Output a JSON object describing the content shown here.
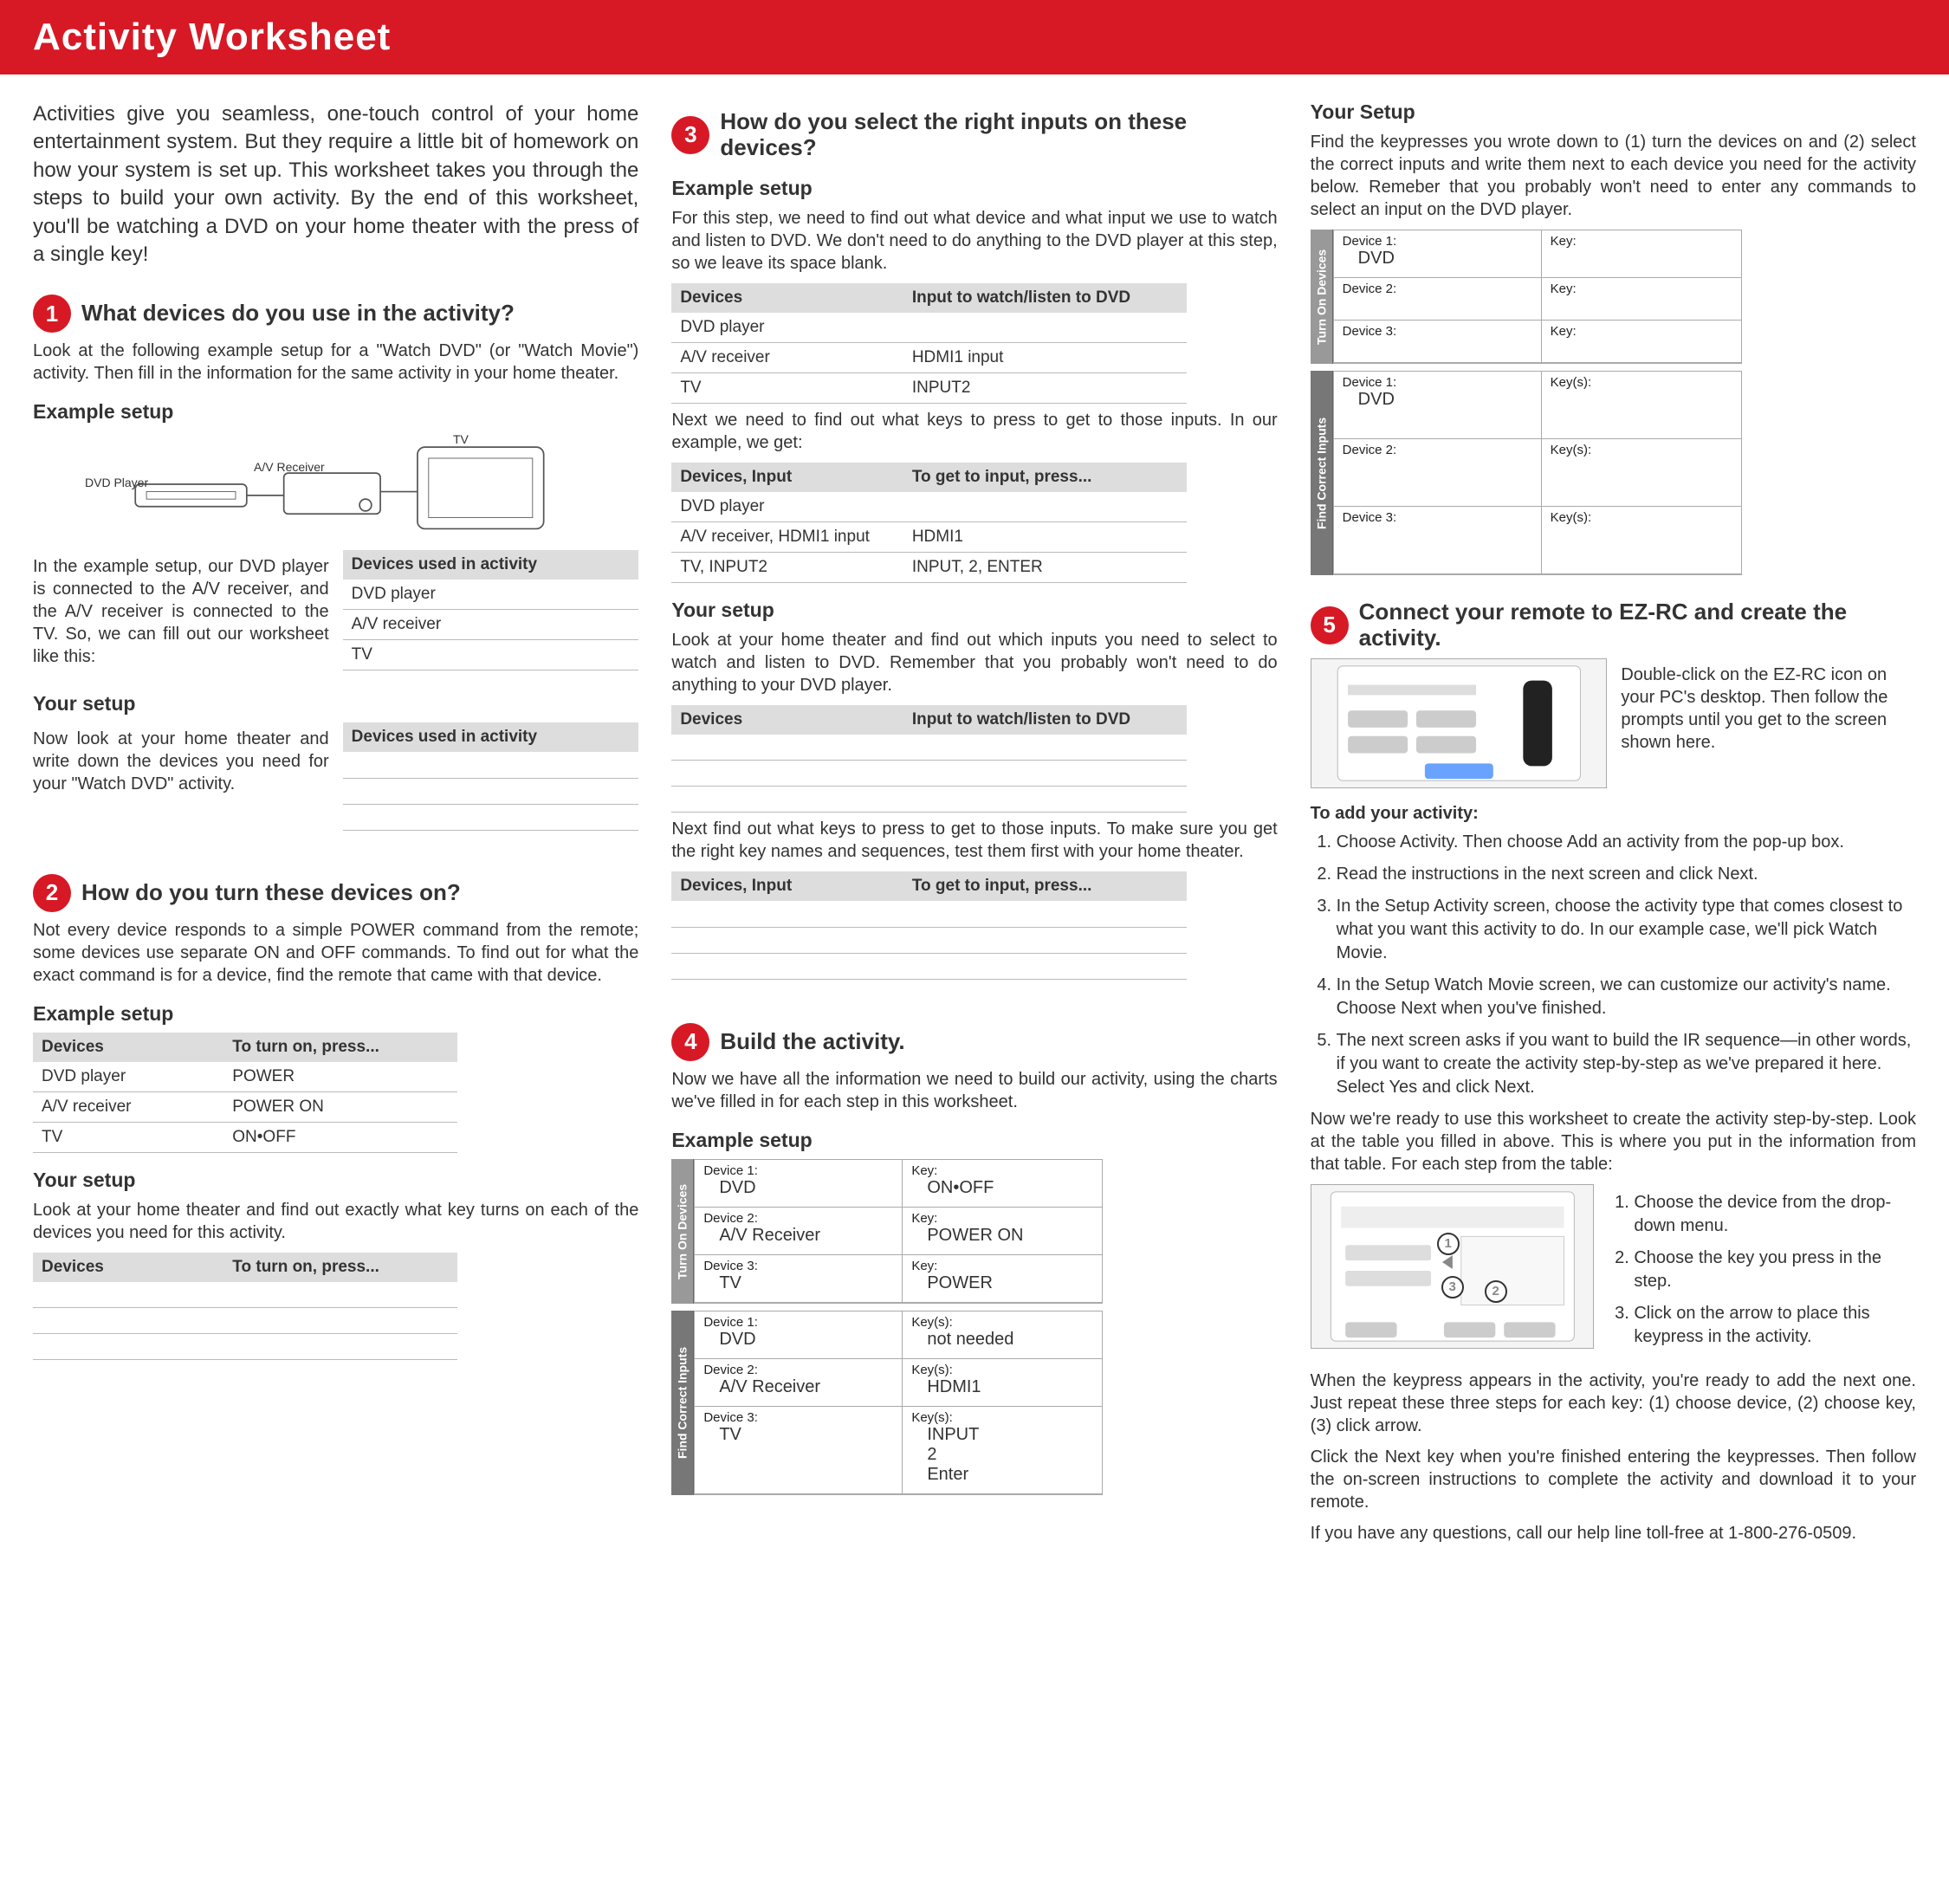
{
  "header": "Activity Worksheet",
  "intro": "Activities give you seamless, one-touch control of your home entertainment system. But they require a little bit of homework on how your system is set up. This worksheet takes you through the steps to build your own activity. By the end of this worksheet, you'll be watching a DVD on your home theater with the press of a single key!",
  "s1": {
    "num": "1",
    "title": "What devices do you use in the activity?",
    "p1": "Look at the following example setup for a \"Watch DVD\" (or \"Watch Movie\") activity. Then fill in the information for the same activity in your home theater.",
    "ex_h": "Example setup",
    "diag": {
      "dvd": "DVD Player",
      "rec": "A/V Receiver",
      "tv": "TV"
    },
    "ex_p": "In the example setup, our DVD player is connected to the A/V receiver, and the A/V receiver is connected to the TV. So, we can fill out our worksheet like this:",
    "ex_tbl_h": "Devices used in activity",
    "ex_tbl": [
      "DVD player",
      "A/V receiver",
      "TV"
    ],
    "ys_h": "Your setup",
    "ys_p": "Now look at your home theater and write down the devices you need for your \"Watch DVD\" activity.",
    "ys_tbl_h": "Devices used in activity"
  },
  "s2": {
    "num": "2",
    "title": "How do you turn these devices on?",
    "p1": "Not every device responds to a simple POWER command from the remote; some devices use separate ON and OFF commands. To find out for what the exact command is for a device, find the remote that came with that device.",
    "ex_h": "Example setup",
    "tbl_h1": "Devices",
    "tbl_h2": "To turn on, press...",
    "rows": [
      {
        "d": "DVD player",
        "k": "POWER"
      },
      {
        "d": "A/V receiver",
        "k": "POWER ON"
      },
      {
        "d": "TV",
        "k": "ON•OFF"
      }
    ],
    "ys_h": "Your setup",
    "ys_p": "Look at your home theater and find out exactly what key turns on each of the devices you need for this activity."
  },
  "s3": {
    "num": "3",
    "title": "How do you select the right inputs on these devices?",
    "ex_h": "Example setup",
    "p1": "For this step, we need to find out what device and what input we use to watch and listen to DVD. We don't need to do anything to the DVD player at this step, so we leave its space blank.",
    "t1h1": "Devices",
    "t1h2": "Input to watch/listen to DVD",
    "t1": [
      {
        "d": "DVD player",
        "i": ""
      },
      {
        "d": "A/V receiver",
        "i": "HDMI1 input"
      },
      {
        "d": "TV",
        "i": "INPUT2"
      }
    ],
    "p2": "Next we need to find out what keys to press to get to those inputs. In our example, we get:",
    "t2h1": "Devices, Input",
    "t2h2": "To get to input, press...",
    "t2": [
      {
        "d": "DVD player",
        "k": ""
      },
      {
        "d": "A/V receiver, HDMI1 input",
        "k": "HDMI1"
      },
      {
        "d": "TV, INPUT2",
        "k": "INPUT, 2, ENTER"
      }
    ],
    "ys_h": "Your setup",
    "ys_p1": "Look at your home theater and find out which inputs you need to select to watch and listen to DVD. Remember that you probably won't need to do anything to your DVD player.",
    "ys_p2": "Next find out what keys to press to get to those inputs. To make sure you get the right key names and sequences, test them first with your home theater."
  },
  "s4": {
    "num": "4",
    "title": "Build the activity.",
    "p1": "Now we have all the information we need to build our activity, using the charts we've filled in for each step in this worksheet.",
    "ex_h": "Example setup",
    "vtab1": "Turn On Devices",
    "vtab2": "Find Correct Inputs",
    "rows_on": [
      {
        "l1": "Device 1:",
        "v1": "DVD",
        "l2": "Key:",
        "v2": "ON•OFF"
      },
      {
        "l1": "Device 2:",
        "v1": "A/V Receiver",
        "l2": "Key:",
        "v2": "POWER ON"
      },
      {
        "l1": "Device 3:",
        "v1": "TV",
        "l2": "Key:",
        "v2": "POWER"
      }
    ],
    "rows_in": [
      {
        "l1": "Device 1:",
        "v1": "DVD",
        "l2": "Key(s):",
        "v2": "not needed"
      },
      {
        "l1": "Device 2:",
        "v1": "A/V Receiver",
        "l2": "Key(s):",
        "v2": "HDMI1"
      },
      {
        "l1": "Device 3:",
        "v1": "TV",
        "l2": "Key(s):",
        "v2": "INPUT\n2\nEnter"
      }
    ]
  },
  "ys4": {
    "h": "Your Setup",
    "p": "Find the keypresses you wrote down to (1) turn the devices on and (2) select the correct inputs and write them next to each device you need for the activity below. Remeber that you probably won't need to enter any commands to select an input on the DVD player.",
    "vtab1": "Turn On Devices",
    "vtab2": "Find Correct Inputs",
    "rows_on": [
      {
        "l1": "Device 1:",
        "v1": "DVD",
        "l2": "Key:",
        "v2": ""
      },
      {
        "l1": "Device 2:",
        "v1": "",
        "l2": "Key:",
        "v2": ""
      },
      {
        "l1": "Device 3:",
        "v1": "",
        "l2": "Key:",
        "v2": ""
      }
    ],
    "rows_in": [
      {
        "l1": "Device 1:",
        "v1": "DVD",
        "l2": "Key(s):",
        "v2": ""
      },
      {
        "l1": "Device 2:",
        "v1": "",
        "l2": "Key(s):",
        "v2": ""
      },
      {
        "l1": "Device 3:",
        "v1": "",
        "l2": "Key(s):",
        "v2": ""
      }
    ]
  },
  "s5": {
    "num": "5",
    "title": "Connect your remote to EZ-RC and create the activity.",
    "shot_p": "Double-click on the EZ-RC icon on your PC's desktop. Then follow the prompts until you get to the screen shown here.",
    "add_h": "To add your activity:",
    "ol": [
      "Choose Activity. Then choose Add an activity from the pop-up box.",
      "Read the instructions in the next screen and click Next.",
      "In the Setup Activity screen, choose the activity type that comes closest to what you want this activity to do. In our example case, we'll pick Watch Movie.",
      "In the Setup Watch Movie screen, we can customize our activity's name. Choose Next when you've finished.",
      "The next screen asks if you want to build the IR sequence—in other words, if you want to create the activity step-by-step as we've prepared it here. Select Yes and click Next."
    ],
    "p2": "Now we're ready to use this worksheet to create the activity step-by-step. Look at the table you filled in above. This is where you put in the information from that table. For each step from the table:",
    "ol2": [
      "Choose the device from the drop-down menu.",
      "Choose the key you press in the step.",
      "Click on the arrow to place this keypress in the activity."
    ],
    "p3": "When the keypress appears in the activity, you're ready to add the next one. Just repeat these three steps for each key: (1) choose device, (2) choose key, (3) click arrow.",
    "p4": "Click the Next key when you're finished entering the keypresses. Then follow the on-screen instructions to complete the activity and download it to your remote.",
    "p5": "If you have any questions, call our help line toll-free at 1-800-276-0509.",
    "mc1": "1",
    "mc2": "2",
    "mc3": "3"
  }
}
